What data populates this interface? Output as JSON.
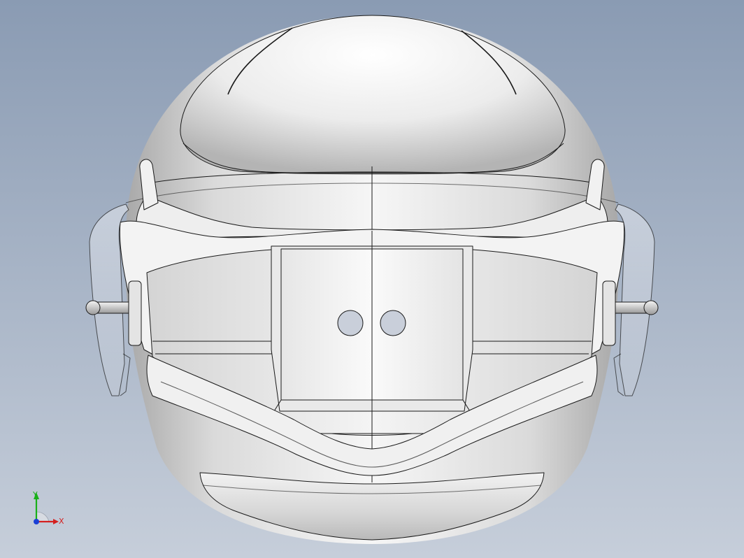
{
  "viewport": {
    "background_top": "#8a9bb3",
    "background_bottom": "#c6ceda",
    "model_name": "helmet-model"
  },
  "colors": {
    "shell_light": "#fbfbfb",
    "shell_mid": "#e2e2e2",
    "shell_dark": "#a9a9a9",
    "edge": "#1a1a1a",
    "visor_tint": "#dfe3ea",
    "hole_fill": "#c9cfda"
  },
  "triad": {
    "x_label": "X",
    "y_label": "Y",
    "x_color": "#d42020",
    "y_color": "#19b019",
    "z_color": "#1a3fd6"
  }
}
